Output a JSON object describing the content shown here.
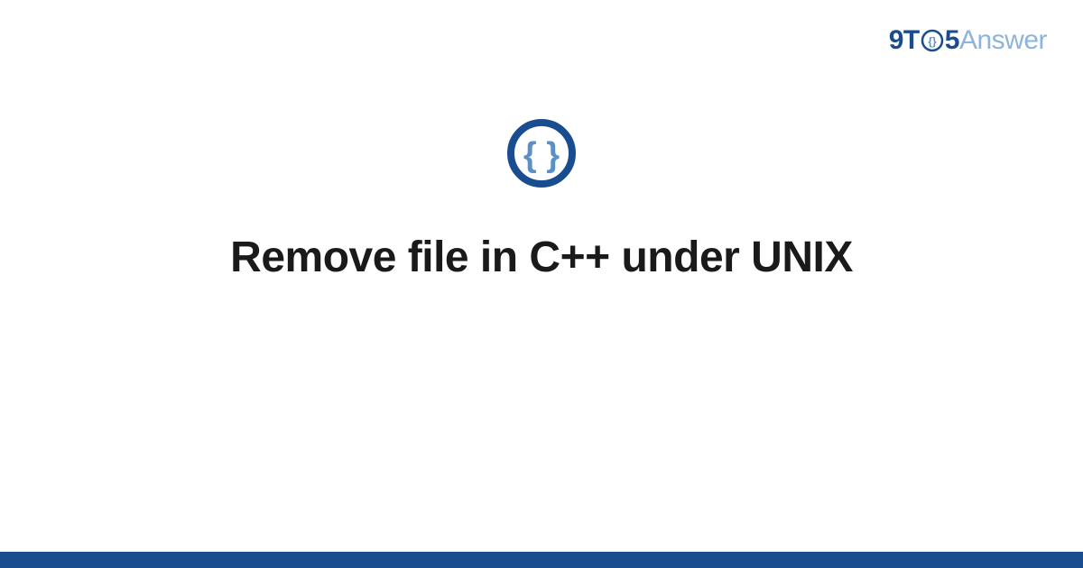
{
  "logo": {
    "part1": "9T",
    "part2": "5",
    "part3": "Answer"
  },
  "main": {
    "title": "Remove file in C++ under UNIX",
    "icon_name": "code-braces-icon"
  },
  "colors": {
    "primary": "#1a4d8f",
    "accent": "#5a8fc7",
    "light_accent": "#8db4dc",
    "text": "#1a1a1a"
  }
}
